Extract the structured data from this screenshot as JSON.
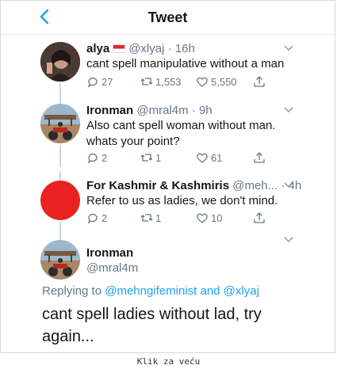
{
  "header": {
    "title": "Tweet"
  },
  "tweets": [
    {
      "name": "alya",
      "handle": "@xlyaj",
      "time": "16h",
      "text": "cant spell manipulative without a man",
      "replies": "27",
      "retweets": "1,553",
      "likes": "5,550"
    },
    {
      "name": "Ironman",
      "handle": "@mral4m",
      "time": "9h",
      "text_line1": "Also cant spell woman without man.",
      "text_line2": "whats your point?",
      "replies": "2",
      "retweets": "1",
      "likes": "61"
    },
    {
      "name": "For Kashmir & Kashmiris",
      "handle": "@meh...",
      "time": "4h",
      "text": "Refer to us as ladies, we don't mind.",
      "replies": "2",
      "retweets": "1",
      "likes": "10"
    }
  ],
  "main": {
    "name": "Ironman",
    "handle": "@mral4m",
    "replying_prefix": "Replying to",
    "replying_users": "@mehngifeminist and @xlyaj",
    "text_line1": "cant spell ladies without lad, try",
    "text_line2": "again..."
  },
  "caption": "Klik za veću",
  "colors": {
    "accent": "#1da1f2",
    "secondary_text": "#657786",
    "kashmir_avatar": "#e8231f"
  }
}
